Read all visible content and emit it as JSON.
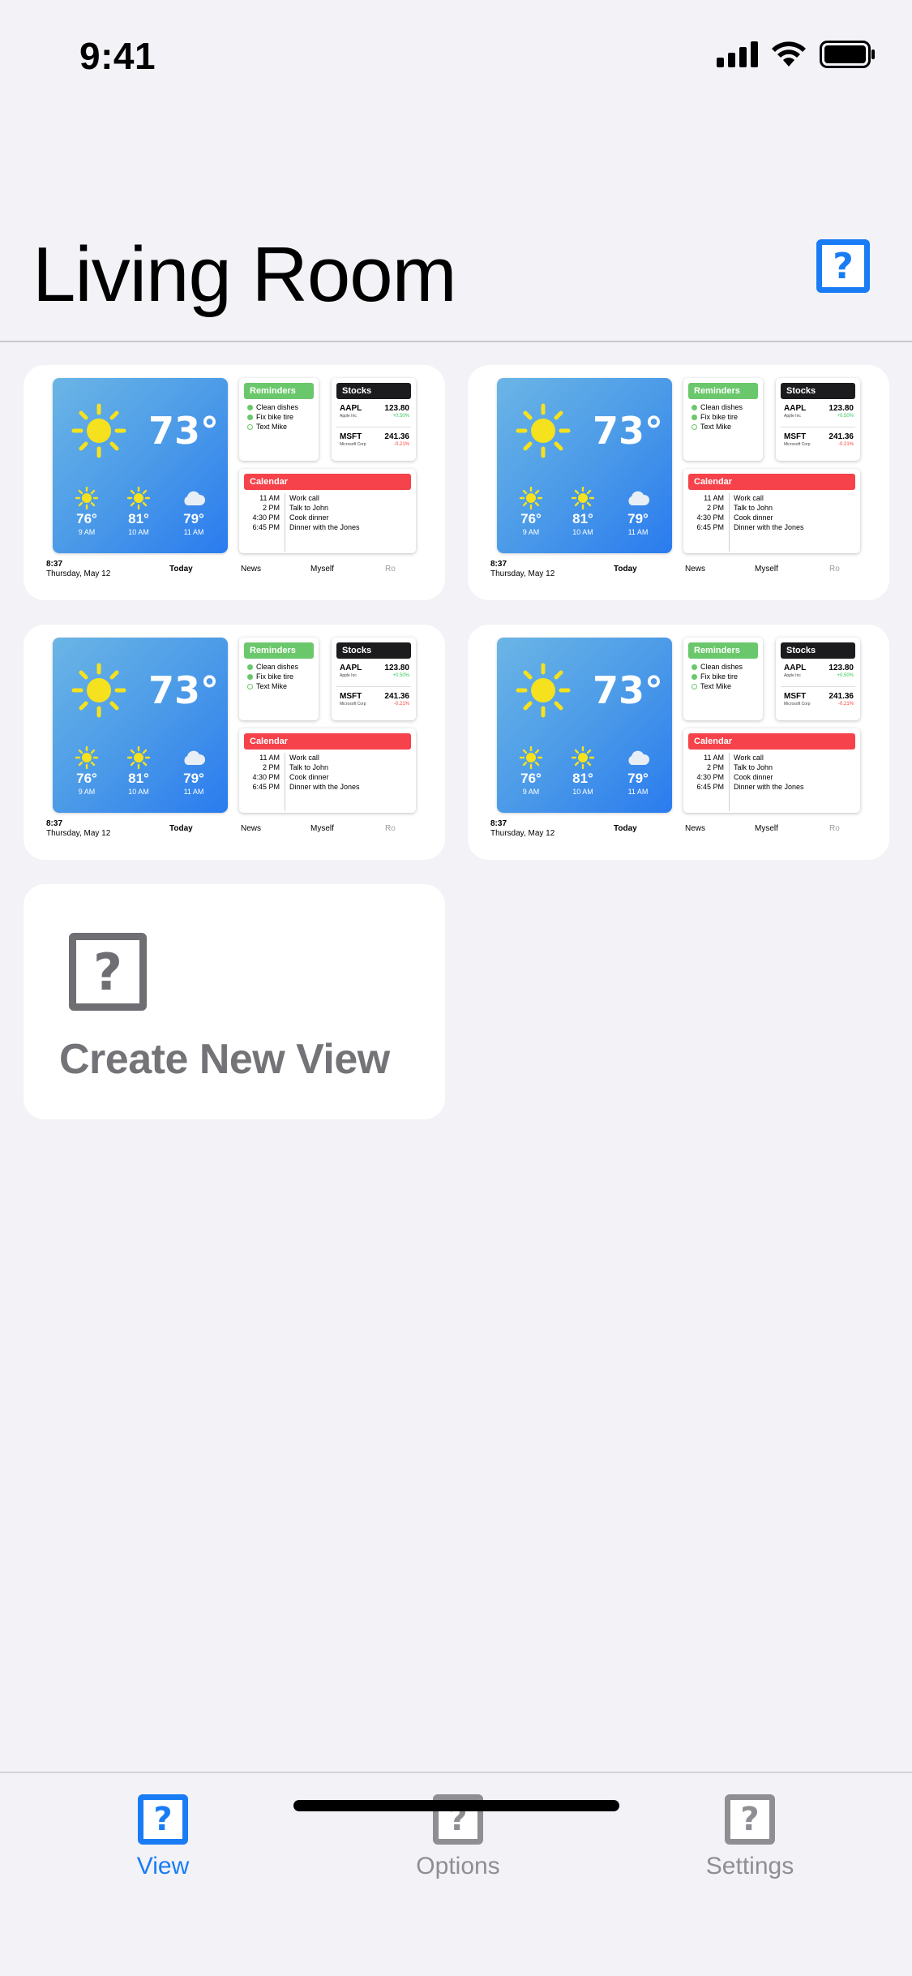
{
  "status_bar": {
    "time": "9:41"
  },
  "header": {
    "title": "Living Room",
    "help_icon": "question-box-icon"
  },
  "colors": {
    "accent": "#1a7cf5",
    "reminders": "#6bc76b",
    "stocks": "#1c1c1e",
    "calendar": "#f6424a",
    "stock_up": "#34c759",
    "stock_down": "#ff3b30"
  },
  "view_preview": {
    "weather": {
      "current_temp": "73°",
      "hours": [
        {
          "temp": "76°",
          "time": "9 AM",
          "icon": "sun-icon"
        },
        {
          "temp": "81°",
          "time": "10 AM",
          "icon": "sun-icon"
        },
        {
          "temp": "79°",
          "time": "11 AM",
          "icon": "cloud-icon"
        }
      ]
    },
    "reminders": {
      "title": "Reminders",
      "items": [
        {
          "text": "Clean dishes",
          "done": true
        },
        {
          "text": "Fix bike tire",
          "done": true
        },
        {
          "text": "Text Mike",
          "done": false
        }
      ]
    },
    "stocks": {
      "title": "Stocks",
      "items": [
        {
          "symbol": "AAPL",
          "name": "Apple Inc",
          "price": "123.80",
          "change": "+0.50%"
        },
        {
          "symbol": "MSFT",
          "name": "Microsoft Corp",
          "price": "241.36",
          "change": "-0.21%"
        }
      ]
    },
    "calendar": {
      "title": "Calendar",
      "events": [
        {
          "time": "11 AM",
          "title": "Work call"
        },
        {
          "time": "2 PM",
          "title": "Talk to John"
        },
        {
          "time": "4:30 PM",
          "title": "Cook dinner"
        },
        {
          "time": "6:45 PM",
          "title": "Dinner with the Jones"
        }
      ]
    },
    "footer": {
      "clock": "8:37",
      "date": "Thursday, May 12",
      "tabs": [
        "Today",
        "News",
        "Myself",
        "Ro"
      ]
    }
  },
  "create_card": {
    "label": "Create New View",
    "icon": "question-box-icon"
  },
  "tab_bar": {
    "tabs": [
      {
        "label": "View",
        "icon": "question-box-icon",
        "active": true
      },
      {
        "label": "Options",
        "icon": "question-box-icon",
        "active": false
      },
      {
        "label": "Settings",
        "icon": "question-box-icon",
        "active": false
      }
    ]
  }
}
